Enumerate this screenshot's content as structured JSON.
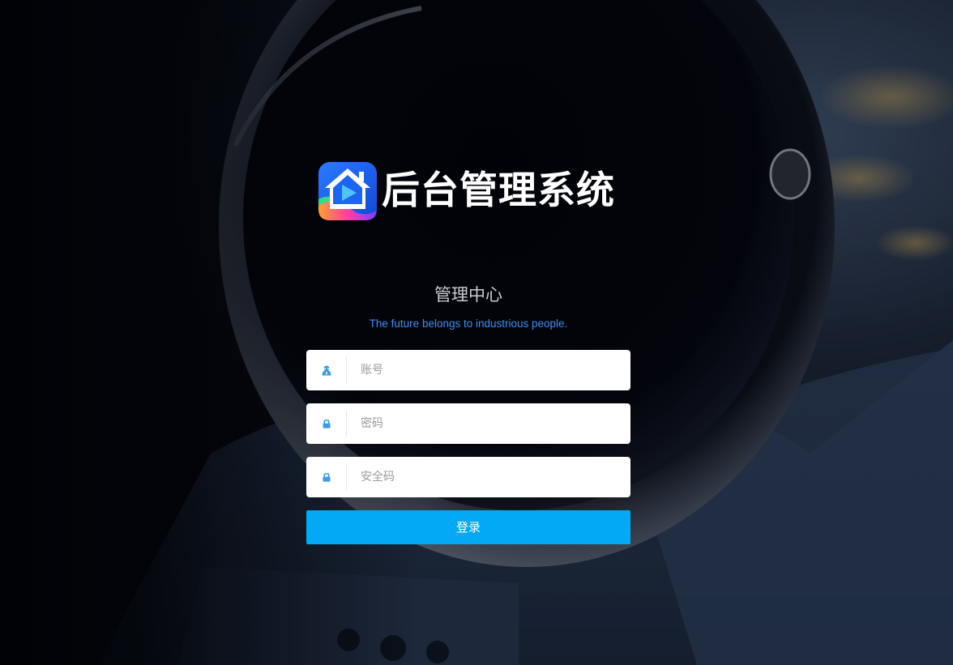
{
  "brand": {
    "title": "后台管理系统",
    "logo": "house-play-app-icon"
  },
  "login": {
    "subtitle": "管理中心",
    "slogan": "The future belongs to industrious people.",
    "fields": [
      {
        "name": "account",
        "placeholder": "账号",
        "value": "",
        "icon": "user-icon"
      },
      {
        "name": "password",
        "placeholder": "密码",
        "value": "",
        "icon": "lock-icon"
      },
      {
        "name": "security_code",
        "placeholder": "安全码",
        "value": "",
        "icon": "lock-icon"
      }
    ],
    "submit_label": "登录"
  },
  "colors": {
    "accent": "#03a9f4",
    "slogan": "#3d8ff2",
    "icon": "#3d9be9",
    "background": "#05080f"
  },
  "background_image": "astronaut-helmet-night-sky"
}
